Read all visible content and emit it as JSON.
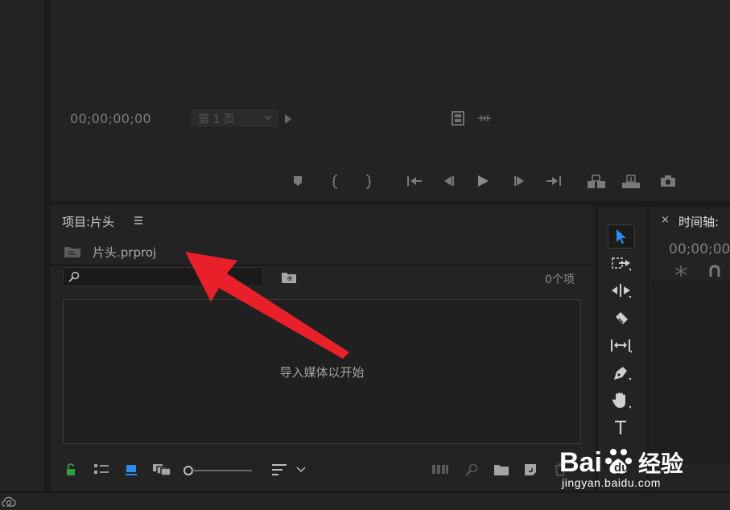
{
  "program_monitor": {
    "timecode": "00;00;00;00",
    "page_select": "第 1 页"
  },
  "project_panel": {
    "title": "项目:片头",
    "file_name": "片头.prproj",
    "search_placeholder": "",
    "item_count": "0个项",
    "empty_hint": "导入媒体以开始"
  },
  "timeline": {
    "close_glyph": "×",
    "title": "时间轴:",
    "timecode": "00;00;00"
  },
  "annotation": {
    "arrow_color": "#e8202a"
  },
  "watermark": {
    "logo": "Baidu经验",
    "url": "jingyan.baidu.com"
  },
  "colors": {
    "panel_bg": "#232323",
    "app_bg": "#1b1b1b",
    "accent_blue": "#2d8ceb",
    "lock_green": "#2ea043"
  },
  "icons": {
    "monitor_controls": [
      "add-marker-icon",
      "mark-in-icon",
      "mark-out-icon",
      "go-to-in-icon",
      "step-back-icon",
      "play-icon",
      "step-forward-icon",
      "go-to-out-icon",
      "insert-icon",
      "overwrite-icon",
      "export-frame-icon"
    ],
    "project_bottom": [
      "lock-icon",
      "list-view-icon",
      "icon-view-icon",
      "freeform-view-icon",
      "zoom-slider",
      "sort-icon",
      "automate-to-sequence-icon",
      "find-icon",
      "new-bin-icon",
      "new-item-icon",
      "clear-icon"
    ],
    "tools": [
      "selection-tool-icon",
      "track-select-tool-icon",
      "ripple-edit-tool-icon",
      "razor-tool-icon",
      "slip-tool-icon",
      "pen-tool-icon",
      "hand-tool-icon",
      "type-tool-icon"
    ]
  }
}
